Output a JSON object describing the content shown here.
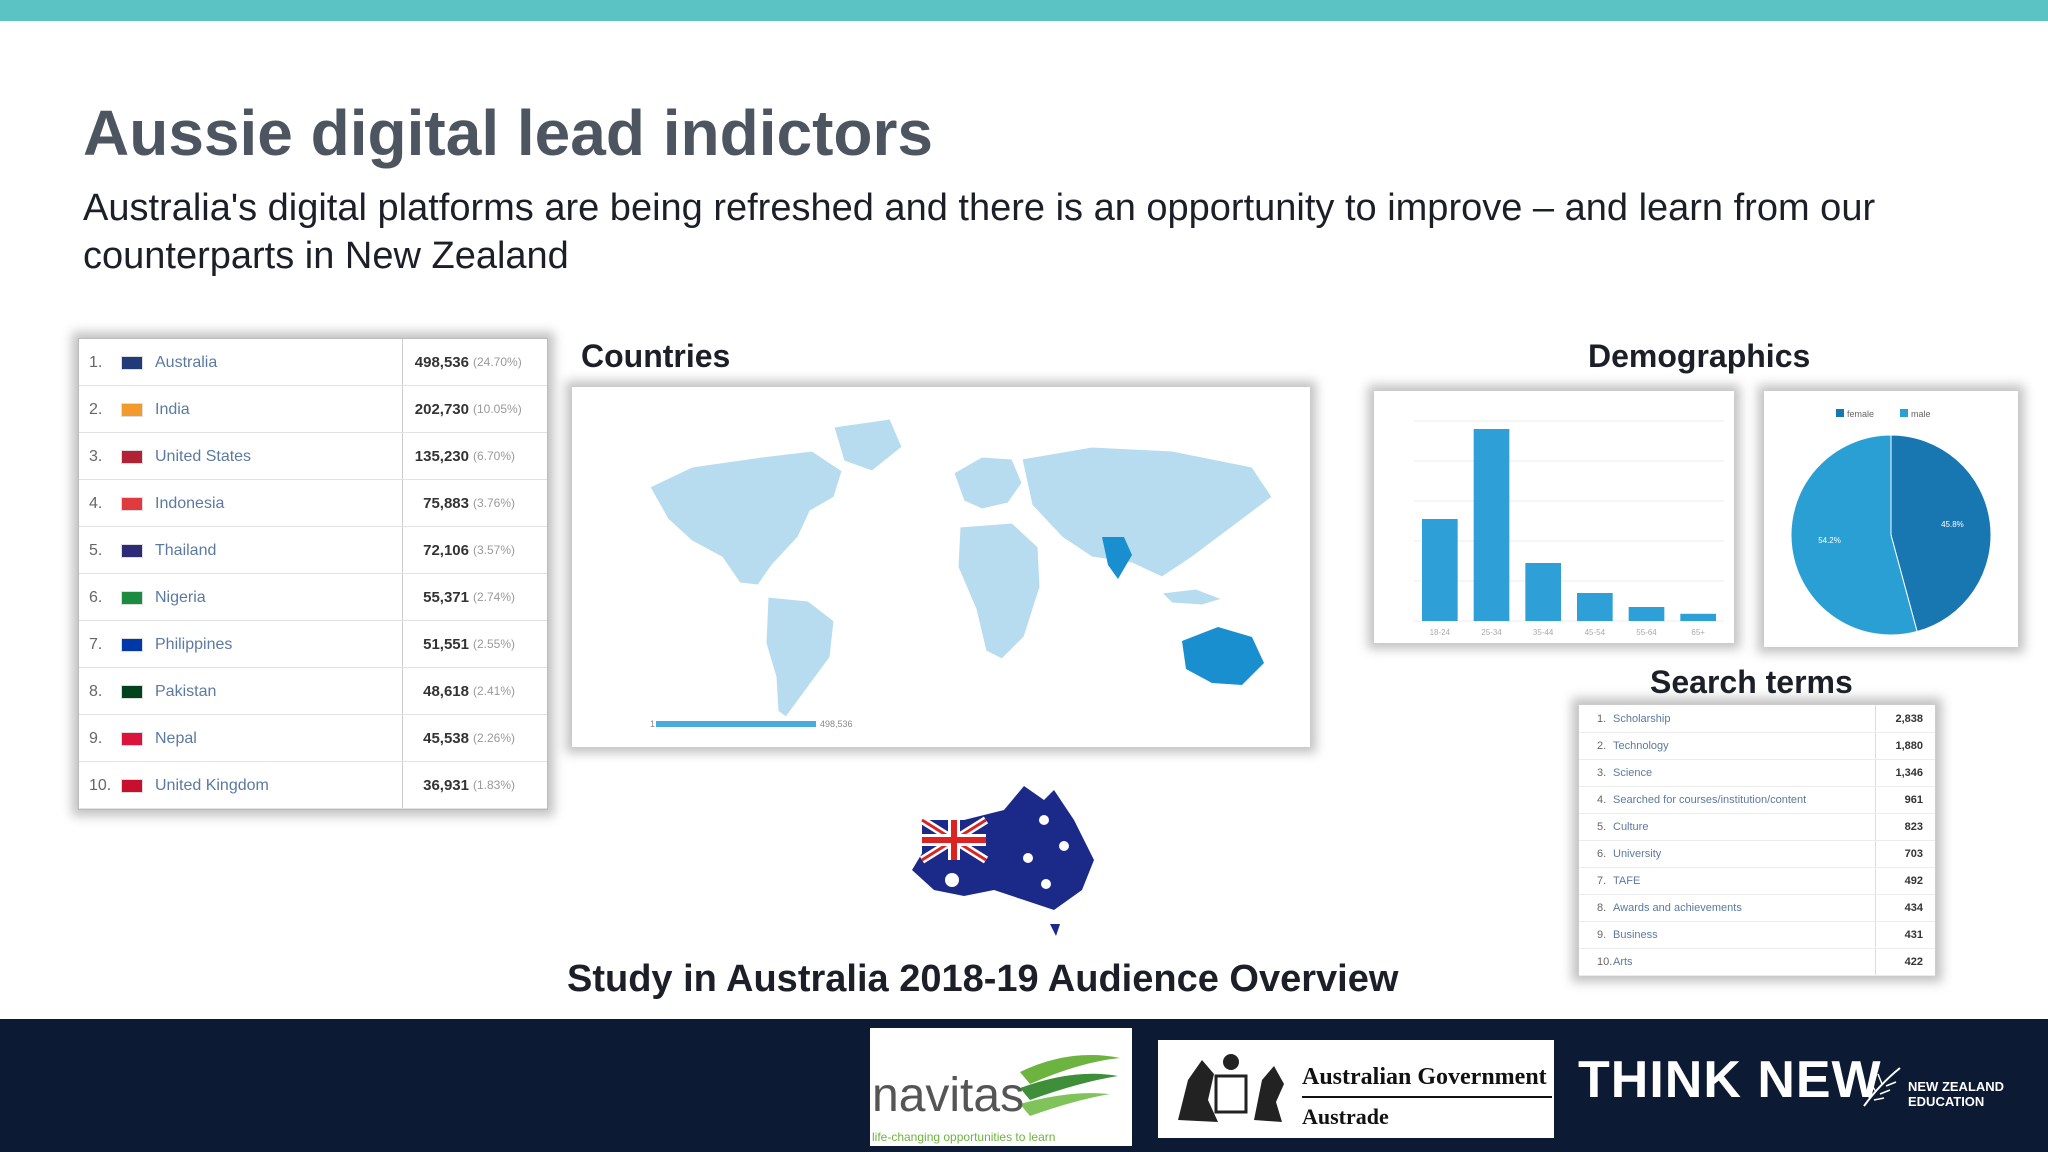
{
  "colors": {
    "topbar": "#5bc3c3",
    "footer": "#0c1a33",
    "map_dark": "#1a8fd0",
    "map_light": "#b7dcf0",
    "bar": "#2f9fd7",
    "pie_female": "#1877b1",
    "pie_male": "#2a9fd4"
  },
  "slide": {
    "title": "Aussie digital lead indictors",
    "subtitle": "Australia's digital platforms are being refreshed and there is an opportunity to improve – and learn from our counterparts in New Zealand",
    "countries_label": "Countries",
    "demographics_label": "Demographics",
    "search_terms_label": "Search terms",
    "caption": "Study in Australia 2018-19 Audience Overview"
  },
  "countries": [
    {
      "rank": "1.",
      "name": "Australia",
      "value": "498,536",
      "pct": "(24.70%)",
      "flag": "#203a7a"
    },
    {
      "rank": "2.",
      "name": "India",
      "value": "202,730",
      "pct": "(10.05%)",
      "flag": "#f39a2d"
    },
    {
      "rank": "3.",
      "name": "United States",
      "value": "135,230",
      "pct": "(6.70%)",
      "flag": "#b22234"
    },
    {
      "rank": "4.",
      "name": "Indonesia",
      "value": "75,883",
      "pct": "(3.76%)",
      "flag": "#e03a3e"
    },
    {
      "rank": "5.",
      "name": "Thailand",
      "value": "72,106",
      "pct": "(3.57%)",
      "flag": "#2d2a77"
    },
    {
      "rank": "6.",
      "name": "Nigeria",
      "value": "55,371",
      "pct": "(2.74%)",
      "flag": "#1a8b3f"
    },
    {
      "rank": "7.",
      "name": "Philippines",
      "value": "51,551",
      "pct": "(2.55%)",
      "flag": "#0038a8"
    },
    {
      "rank": "8.",
      "name": "Pakistan",
      "value": "48,618",
      "pct": "(2.41%)",
      "flag": "#01411c"
    },
    {
      "rank": "9.",
      "name": "Nepal",
      "value": "45,538",
      "pct": "(2.26%)",
      "flag": "#dc143c"
    },
    {
      "rank": "10.",
      "name": "United Kingdom",
      "value": "36,931",
      "pct": "(1.83%)",
      "flag": "#c8102e"
    }
  ],
  "map_legend": {
    "min": "1",
    "max": "498,536"
  },
  "chart_data": [
    {
      "type": "bar",
      "categories": [
        "18-24",
        "25-34",
        "35-44",
        "45-54",
        "55-64",
        "65+"
      ],
      "values": [
        25.5,
        48,
        14.5,
        7,
        3.5,
        1.8
      ],
      "ylim": [
        0,
        50
      ]
    },
    {
      "type": "pie",
      "labels": [
        "female",
        "male"
      ],
      "values": [
        45.8,
        54.2
      ],
      "slice_labels": [
        "45.8%",
        "54.2%"
      ],
      "legend": "top"
    }
  ],
  "search_terms": [
    {
      "rank": "1.",
      "term": "Scholarship",
      "value": "2,838"
    },
    {
      "rank": "2.",
      "term": "Technology",
      "value": "1,880"
    },
    {
      "rank": "3.",
      "term": "Science",
      "value": "1,346"
    },
    {
      "rank": "4.",
      "term": "Searched for courses/institution/content",
      "value": "961"
    },
    {
      "rank": "5.",
      "term": "Culture",
      "value": "823"
    },
    {
      "rank": "6.",
      "term": "University",
      "value": "703"
    },
    {
      "rank": "7.",
      "term": "TAFE",
      "value": "492"
    },
    {
      "rank": "8.",
      "term": "Awards and achievements",
      "value": "434"
    },
    {
      "rank": "9.",
      "term": "Business",
      "value": "431"
    },
    {
      "rank": "10.",
      "term": "Arts",
      "value": "422"
    }
  ],
  "footer": {
    "navitas_name": "navitas",
    "navitas_tagline": "life-changing opportunities to learn",
    "aus_gov_line1": "Australian Government",
    "aus_gov_line2": "Austrade",
    "think_new": "THINK NEW",
    "nz_edu": "NEW ZEALAND EDUCATION"
  }
}
